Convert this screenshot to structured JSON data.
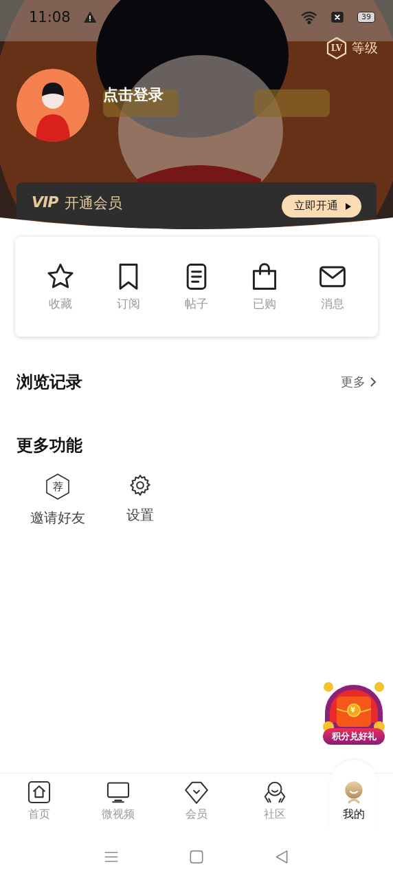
{
  "status_bar": {
    "time": "11:08",
    "battery": "39"
  },
  "level": {
    "badge": "LV",
    "label": "等级"
  },
  "profile": {
    "login_label": "点击登录"
  },
  "vip_banner": {
    "logo": "VIP",
    "title": "开通会员",
    "button": "立即开通"
  },
  "quick_actions": [
    {
      "kind": "star",
      "label": "收藏"
    },
    {
      "kind": "bookmark",
      "label": "订阅"
    },
    {
      "kind": "document",
      "label": "帖子"
    },
    {
      "kind": "bag",
      "label": "已购"
    },
    {
      "kind": "envelope",
      "label": "消息"
    }
  ],
  "history": {
    "title": "浏览记录",
    "more": "更多"
  },
  "features": {
    "title": "更多功能",
    "items": [
      {
        "kind": "invite",
        "badge": "荐",
        "label": "邀请好友"
      },
      {
        "kind": "settings",
        "label": "设置"
      }
    ]
  },
  "promo": {
    "currency": "¥",
    "label": "积分兑好礼"
  },
  "tabs": [
    {
      "kind": "home",
      "label": "首页",
      "selected": false
    },
    {
      "kind": "video",
      "label": "微视频",
      "selected": false
    },
    {
      "kind": "vip",
      "label": "会员",
      "selected": false
    },
    {
      "kind": "community",
      "label": "社区",
      "selected": false
    },
    {
      "kind": "me",
      "label": "我的",
      "selected": true
    }
  ]
}
